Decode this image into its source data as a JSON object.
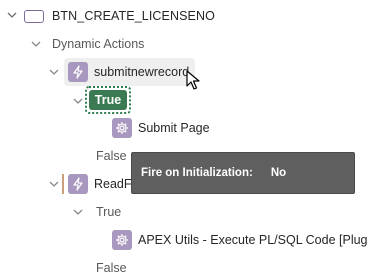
{
  "tree": {
    "button_name": "BTN_CREATE_LICENSENO",
    "dynamic_actions_label": "Dynamic Actions",
    "da1": {
      "name": "submitnewrecord",
      "true_label": "True",
      "action": "Submit Page",
      "false_label": "False"
    },
    "da2": {
      "name": "ReadFromSubmitRecord",
      "true_label": "True",
      "action": "APEX Utils - Execute PL/SQL Code [Plug-I",
      "false_label": "False"
    }
  },
  "tooltip": {
    "key": "Fire on Initialization:",
    "value": "No"
  },
  "colors": {
    "icon_purple": "#a897be",
    "true_green": "#3b7a52",
    "tooltip_bg": "#5f5f5f"
  }
}
